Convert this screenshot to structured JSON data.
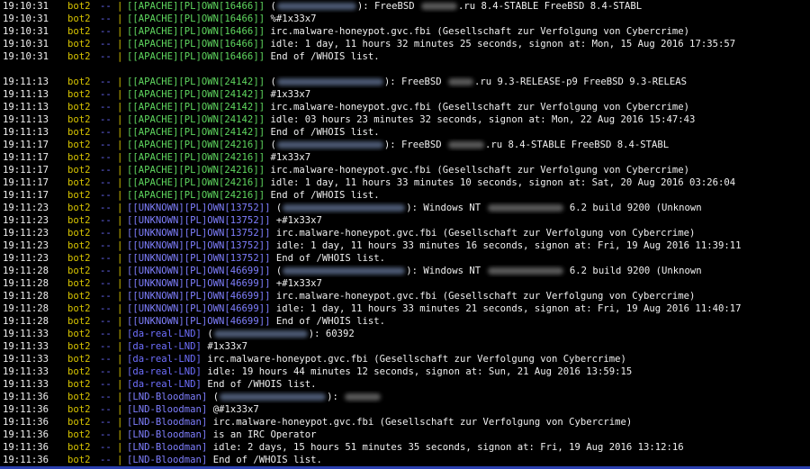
{
  "terminal": {
    "separator": "- - - - - - - - - - - - - - - - - - - - - - - - - - - - - - - - - - - - - - - - - - - - - - - - - - - - - - - - - - - - - - - - - - - - - - - - - - - - - - - - - - - - - - - - - - - -",
    "colors": {
      "background": "#000000",
      "timestamp": "#f0f0f0",
      "bot": "#d7c400",
      "dashes": "#6c6cff",
      "nick_apache": "#5fd75f",
      "nick_unknown": "#7f7fff",
      "separator": "#c27cc2",
      "bottom_bar": "#2a3fb0"
    },
    "block1": [
      {
        "ts": "19:10:31",
        "bot": "bot2",
        "dd": "--",
        "bar": "|",
        "nick": "[[APACHE][PL]OWN[16466]]",
        "pre": "(",
        "blur1": 88,
        "mid": "): FreeBSD",
        "blur2": 40,
        "post": ".ru 8.4-STABLE FreeBSD 8.4-STABL"
      },
      {
        "ts": "19:10:31",
        "bot": "bot2",
        "dd": "--",
        "bar": "|",
        "nick": "[[APACHE][PL]OWN[16466]]",
        "text": "%#1x33x7"
      },
      {
        "ts": "19:10:31",
        "bot": "bot2",
        "dd": "--",
        "bar": "|",
        "nick": "[[APACHE][PL]OWN[16466]]",
        "text": "irc.malware-honeypot.gvc.fbi (Gesellschaft zur Verfolgung von Cybercrime)"
      },
      {
        "ts": "19:10:31",
        "bot": "bot2",
        "dd": "--",
        "bar": "|",
        "nick": "[[APACHE][PL]OWN[16466]]",
        "text": "idle: 1 day, 11 hours 32 minutes 25 seconds, signon at: Mon, 15 Aug 2016 17:35:57"
      },
      {
        "ts": "19:10:31",
        "bot": "bot2",
        "dd": "--",
        "bar": "|",
        "nick": "[[APACHE][PL]OWN[16466]]",
        "text": "End of /WHOIS list."
      }
    ],
    "block2": [
      {
        "ts": "19:11:13",
        "bot": "bot2",
        "dd": "--",
        "bar": "|",
        "nick": "[[APACHE][PL]OWN[24142]]",
        "kind": "apache",
        "pre": "(",
        "blur1": 118,
        "mid": "): FreeBSD",
        "blur2": 28,
        "post": ".ru 9.3-RELEASE-p9 FreeBSD 9.3-RELEAS"
      },
      {
        "ts": "19:11:13",
        "bot": "bot2",
        "dd": "--",
        "bar": "|",
        "nick": "[[APACHE][PL]OWN[24142]]",
        "kind": "apache",
        "text": "#1x33x7"
      },
      {
        "ts": "19:11:13",
        "bot": "bot2",
        "dd": "--",
        "bar": "|",
        "nick": "[[APACHE][PL]OWN[24142]]",
        "kind": "apache",
        "text": "irc.malware-honeypot.gvc.fbi (Gesellschaft zur Verfolgung von Cybercrime)"
      },
      {
        "ts": "19:11:13",
        "bot": "bot2",
        "dd": "--",
        "bar": "|",
        "nick": "[[APACHE][PL]OWN[24142]]",
        "kind": "apache",
        "text": "idle: 03 hours 23 minutes 32 seconds, signon at: Mon, 22 Aug 2016 15:47:43"
      },
      {
        "ts": "19:11:13",
        "bot": "bot2",
        "dd": "--",
        "bar": "|",
        "nick": "[[APACHE][PL]OWN[24142]]",
        "kind": "apache",
        "text": "End of /WHOIS list."
      },
      {
        "ts": "19:11:17",
        "bot": "bot2",
        "dd": "--",
        "bar": "|",
        "nick": "[[APACHE][PL]OWN[24216]]",
        "kind": "apache",
        "pre": "(",
        "blur1": 118,
        "mid": "): FreeBSD",
        "blur2": 40,
        "post": ".ru 8.4-STABLE FreeBSD 8.4-STABL"
      },
      {
        "ts": "19:11:17",
        "bot": "bot2",
        "dd": "--",
        "bar": "|",
        "nick": "[[APACHE][PL]OWN[24216]]",
        "kind": "apache",
        "text": "#1x33x7"
      },
      {
        "ts": "19:11:17",
        "bot": "bot2",
        "dd": "--",
        "bar": "|",
        "nick": "[[APACHE][PL]OWN[24216]]",
        "kind": "apache",
        "text": "irc.malware-honeypot.gvc.fbi (Gesellschaft zur Verfolgung von Cybercrime)"
      },
      {
        "ts": "19:11:17",
        "bot": "bot2",
        "dd": "--",
        "bar": "|",
        "nick": "[[APACHE][PL]OWN[24216]]",
        "kind": "apache",
        "text": "idle: 1 day, 11 hours 33 minutes 10 seconds, signon at: Sat, 20 Aug 2016 03:26:04"
      },
      {
        "ts": "19:11:17",
        "bot": "bot2",
        "dd": "--",
        "bar": "|",
        "nick": "[[APACHE][PL]OWN[24216]]",
        "kind": "apache",
        "text": "End of /WHOIS list."
      },
      {
        "ts": "19:11:23",
        "bot": "bot2",
        "dd": "--",
        "bar": "|",
        "nick": "[[UNKNOWN][PL]OWN[13752]]",
        "kind": "unknown",
        "pre": "(",
        "blur1": 136,
        "mid": "): Windows NT",
        "blur2": 84,
        "post": " 6.2 build 9200 (Unknown"
      },
      {
        "ts": "19:11:23",
        "bot": "bot2",
        "dd": "--",
        "bar": "|",
        "nick": "[[UNKNOWN][PL]OWN[13752]]",
        "kind": "unknown",
        "text": "+#1x33x7"
      },
      {
        "ts": "19:11:23",
        "bot": "bot2",
        "dd": "--",
        "bar": "|",
        "nick": "[[UNKNOWN][PL]OWN[13752]]",
        "kind": "unknown",
        "text": "irc.malware-honeypot.gvc.fbi (Gesellschaft zur Verfolgung von Cybercrime)"
      },
      {
        "ts": "19:11:23",
        "bot": "bot2",
        "dd": "--",
        "bar": "|",
        "nick": "[[UNKNOWN][PL]OWN[13752]]",
        "kind": "unknown",
        "text": "idle: 1 day, 11 hours 33 minutes 16 seconds, signon at: Fri, 19 Aug 2016 11:39:11"
      },
      {
        "ts": "19:11:23",
        "bot": "bot2",
        "dd": "--",
        "bar": "|",
        "nick": "[[UNKNOWN][PL]OWN[13752]]",
        "kind": "unknown",
        "text": "End of /WHOIS list."
      },
      {
        "ts": "19:11:28",
        "bot": "bot2",
        "dd": "--",
        "bar": "|",
        "nick": "[[UNKNOWN][PL]OWN[46699]]",
        "kind": "unknown",
        "pre": "(",
        "blur1": 136,
        "mid": "): Windows NT",
        "blur2": 84,
        "post": " 6.2 build 9200 (Unknown"
      },
      {
        "ts": "19:11:28",
        "bot": "bot2",
        "dd": "--",
        "bar": "|",
        "nick": "[[UNKNOWN][PL]OWN[46699]]",
        "kind": "unknown",
        "text": "+#1x33x7"
      },
      {
        "ts": "19:11:28",
        "bot": "bot2",
        "dd": "--",
        "bar": "|",
        "nick": "[[UNKNOWN][PL]OWN[46699]]",
        "kind": "unknown",
        "text": "irc.malware-honeypot.gvc.fbi (Gesellschaft zur Verfolgung von Cybercrime)"
      },
      {
        "ts": "19:11:28",
        "bot": "bot2",
        "dd": "--",
        "bar": "|",
        "nick": "[[UNKNOWN][PL]OWN[46699]]",
        "kind": "unknown",
        "text": "idle: 1 day, 11 hours 33 minutes 21 seconds, signon at: Fri, 19 Aug 2016 11:40:17"
      },
      {
        "ts": "19:11:28",
        "bot": "bot2",
        "dd": "--",
        "bar": "|",
        "nick": "[[UNKNOWN][PL]OWN[46699]]",
        "kind": "unknown",
        "text": "End of /WHOIS list."
      },
      {
        "ts": "19:11:33",
        "bot": "bot2",
        "dd": "--",
        "bar": "|",
        "nick": "[da-real-LND]",
        "kind": "real",
        "pre": "(",
        "blur1": 104,
        "mid": "): 60392"
      },
      {
        "ts": "19:11:33",
        "bot": "bot2",
        "dd": "--",
        "bar": "|",
        "nick": "[da-real-LND]",
        "kind": "real",
        "text": "#1x33x7"
      },
      {
        "ts": "19:11:33",
        "bot": "bot2",
        "dd": "--",
        "bar": "|",
        "nick": "[da-real-LND]",
        "kind": "real",
        "text": "irc.malware-honeypot.gvc.fbi (Gesellschaft zur Verfolgung von Cybercrime)"
      },
      {
        "ts": "19:11:33",
        "bot": "bot2",
        "dd": "--",
        "bar": "|",
        "nick": "[da-real-LND]",
        "kind": "real",
        "text": "idle: 19 hours 44 minutes 12 seconds, signon at: Sun, 21 Aug 2016 13:59:15"
      },
      {
        "ts": "19:11:33",
        "bot": "bot2",
        "dd": "--",
        "bar": "|",
        "nick": "[da-real-LND]",
        "kind": "real",
        "text": "End of /WHOIS list."
      },
      {
        "ts": "19:11:36",
        "bot": "bot2",
        "dd": "--",
        "bar": "|",
        "nick": "[LND-Bloodman]",
        "kind": "blood",
        "pre": "(",
        "blur1": 118,
        "mid": "):",
        "blur2": 40,
        "post": ""
      },
      {
        "ts": "19:11:36",
        "bot": "bot2",
        "dd": "--",
        "bar": "|",
        "nick": "[LND-Bloodman]",
        "kind": "blood",
        "text": "@#1x33x7"
      },
      {
        "ts": "19:11:36",
        "bot": "bot2",
        "dd": "--",
        "bar": "|",
        "nick": "[LND-Bloodman]",
        "kind": "blood",
        "text": "irc.malware-honeypot.gvc.fbi (Gesellschaft zur Verfolgung von Cybercrime)"
      },
      {
        "ts": "19:11:36",
        "bot": "bot2",
        "dd": "--",
        "bar": "|",
        "nick": "[LND-Bloodman]",
        "kind": "blood",
        "text": "is an IRC Operator"
      },
      {
        "ts": "19:11:36",
        "bot": "bot2",
        "dd": "--",
        "bar": "|",
        "nick": "[LND-Bloodman]",
        "kind": "blood",
        "text": "idle: 2 days, 15 hours 51 minutes 35 seconds, signon at: Fri, 19 Aug 2016 13:12:16"
      },
      {
        "ts": "19:11:36",
        "bot": "bot2",
        "dd": "--",
        "bar": "|",
        "nick": "[LND-Bloodman]",
        "kind": "blood",
        "text": "End of /WHOIS list."
      }
    ]
  }
}
